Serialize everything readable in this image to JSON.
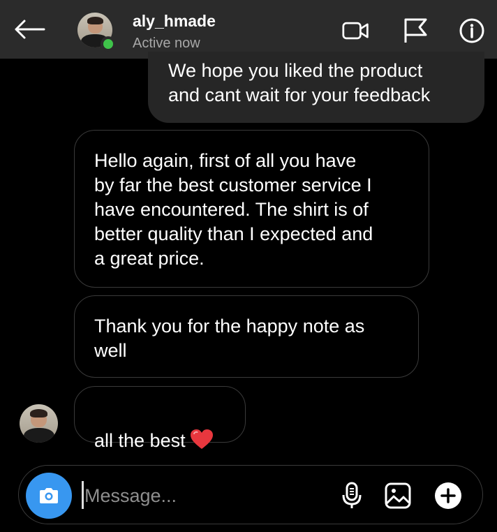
{
  "header": {
    "back_icon": "arrow-left-icon",
    "username": "aly_hmade",
    "status": "Active now",
    "icons": [
      "video-call-icon",
      "flag-icon",
      "info-icon"
    ]
  },
  "messages": [
    {
      "direction": "outgoing",
      "text": "We hope you liked the product\nand cant wait for your feedback"
    },
    {
      "direction": "incoming",
      "text": "Hello again, first of all you have\nby far the best customer service I\nhave encountered. The shirt is of\nbetter quality than I expected and\na great price."
    },
    {
      "direction": "incoming",
      "text": "Thank you for the happy note as\nwell"
    },
    {
      "direction": "incoming",
      "text": "all the best",
      "emoji": "red-heart"
    }
  ],
  "composer": {
    "placeholder": "Message...",
    "value": "",
    "icons": [
      "camera-icon",
      "microphone-icon",
      "gallery-icon",
      "plus-icon"
    ]
  },
  "colors": {
    "header_bg": "#2b2b2b",
    "outgoing_bubble": "#262626",
    "online": "#3fc34a",
    "camera_button": "#3897f0",
    "heart": "#e8373e"
  }
}
